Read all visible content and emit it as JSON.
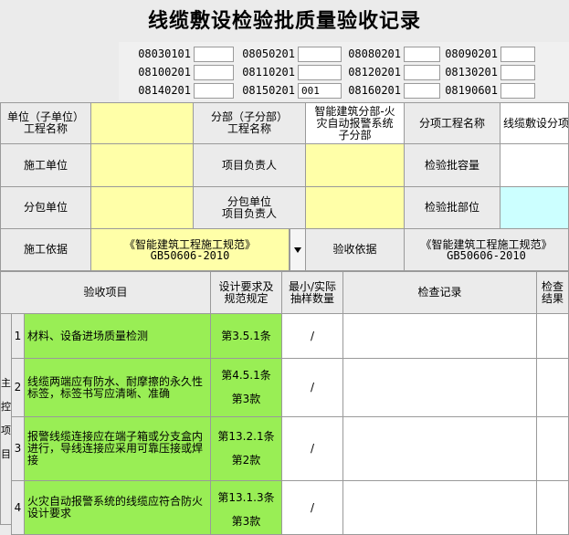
{
  "title": "线缆敷设检验批质量验收记录",
  "codes": [
    {
      "code": "08030101",
      "value": ""
    },
    {
      "code": "08050201",
      "value": ""
    },
    {
      "code": "08080201",
      "value": ""
    },
    {
      "code": "08090201",
      "value": ""
    },
    {
      "code": "08100201",
      "value": ""
    },
    {
      "code": "08110201",
      "value": ""
    },
    {
      "code": "08120201",
      "value": ""
    },
    {
      "code": "08130201",
      "value": ""
    },
    {
      "code": "08140201",
      "value": ""
    },
    {
      "code": "08150201",
      "value": "001"
    },
    {
      "code": "08160201",
      "value": ""
    },
    {
      "code": "08190601",
      "value": ""
    }
  ],
  "info": {
    "unit_label": "单位（子单位）\n工程名称",
    "unit_value": "",
    "part_label": "分部（子分部）\n工程名称",
    "part_value": "智能建筑分部-火\n灾自动报警系统\n子分部",
    "item_label": "分项工程名称",
    "item_value": "线缆敷设分项",
    "constructor_label": "施工单位",
    "constructor_value": "",
    "pm_label": "项目负责人",
    "pm_value": "",
    "capacity_label": "检验批容量",
    "capacity_value": "",
    "sub_label": "分包单位",
    "sub_value": "",
    "sub_pm_label": "分包单位\n项目负责人",
    "sub_pm_value": "",
    "location_label": "检验批部位",
    "location_value": "",
    "basis_label": "施工依据",
    "basis_value": "《智能建筑工程施工规范》\nGB50606-2010",
    "accept_label": "验收依据",
    "accept_value": "《智能建筑工程施工规范》\nGB50606-2010"
  },
  "table": {
    "headers": {
      "item": "验收项目",
      "req": "设计要求及\n规范规定",
      "qty": "最小/实际\n抽样数量",
      "record": "检查记录",
      "result": "检查\n结果"
    },
    "side_label": "主\n控\n项\n目",
    "rows": [
      {
        "no": "1",
        "text": "材料、设备进场质量检测",
        "req": "第3.5.1条",
        "qty": "/"
      },
      {
        "no": "2",
        "text": "线缆两端应有防水、耐摩擦的永久性标签，标签书写应清晰、准确",
        "req": "第4.5.1条\n\n第3款",
        "qty": "/"
      },
      {
        "no": "3",
        "text": "报警线缆连接应在端子箱或分支盒内进行，导线连接应采用可靠压接或焊接",
        "req": "第13.2.1条\n\n第2款",
        "qty": "/"
      },
      {
        "no": "4",
        "text": "火灾自动报警系统的线缆应符合防火设计要求",
        "req": "第13.1.3条\n\n第3款",
        "qty": "/"
      }
    ]
  }
}
